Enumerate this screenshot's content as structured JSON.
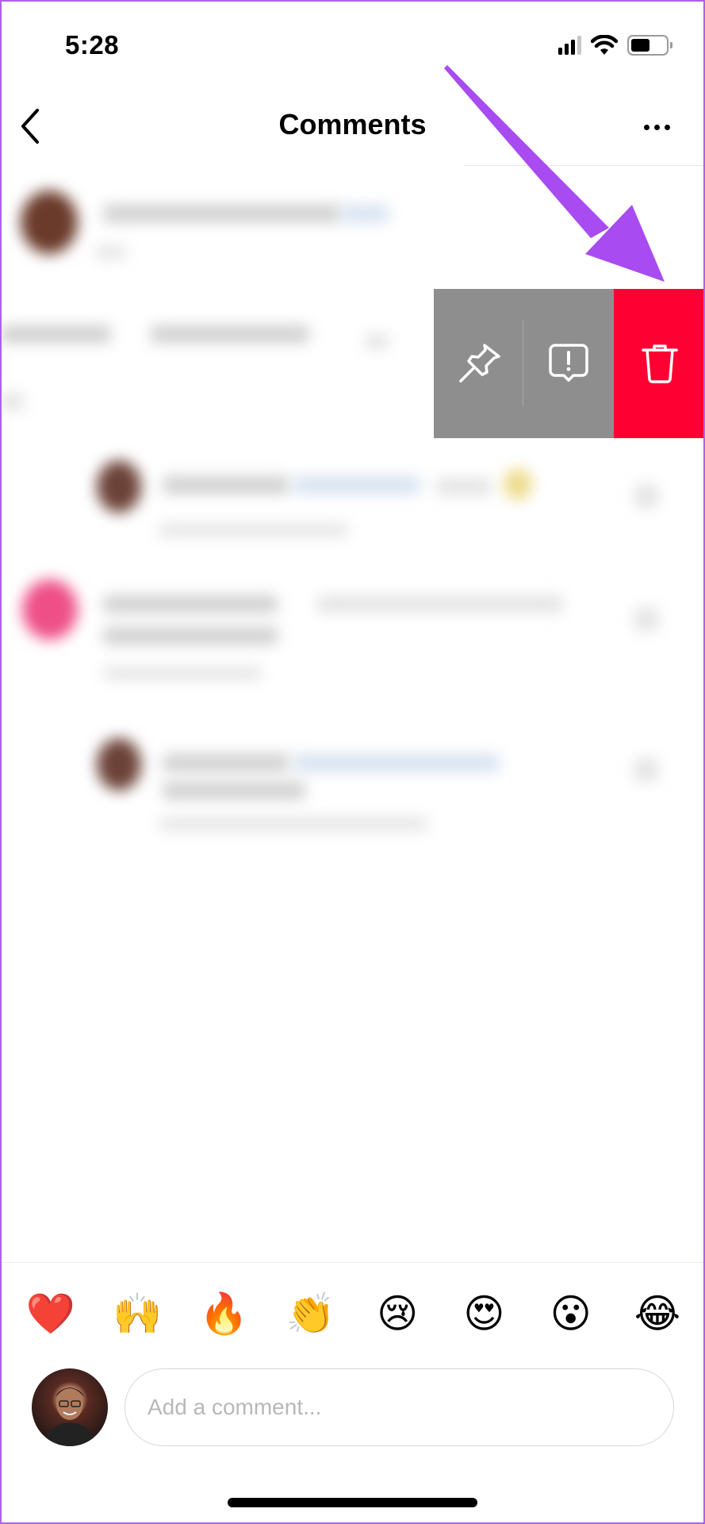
{
  "status_bar": {
    "time": "5:28",
    "signal_bars": 4,
    "signal_active": 3,
    "battery_level": 0.55,
    "icons": [
      "cellular-signal-icon",
      "wifi-icon",
      "battery-icon"
    ]
  },
  "header": {
    "title": "Comments",
    "back_icon": "chevron-left-icon",
    "more_icon": "more-horizontal-icon"
  },
  "swipe_actions": [
    {
      "name": "pin",
      "icon": "pin-icon",
      "color": "#8e8e8e"
    },
    {
      "name": "report",
      "icon": "report-bubble-icon",
      "color": "#8e8e8e"
    },
    {
      "name": "delete",
      "icon": "trash-icon",
      "color": "#ff0033"
    }
  ],
  "annotation": {
    "type": "arrow",
    "color": "#a84bf0",
    "points_to": "delete-action-button"
  },
  "comments_note": "comment contents are blurred",
  "emoji_bar": [
    "❤️",
    "🙌",
    "🔥",
    "👏",
    "😢",
    "😍",
    "😮",
    "😂"
  ],
  "composer": {
    "placeholder": "Add a comment...",
    "value": ""
  }
}
